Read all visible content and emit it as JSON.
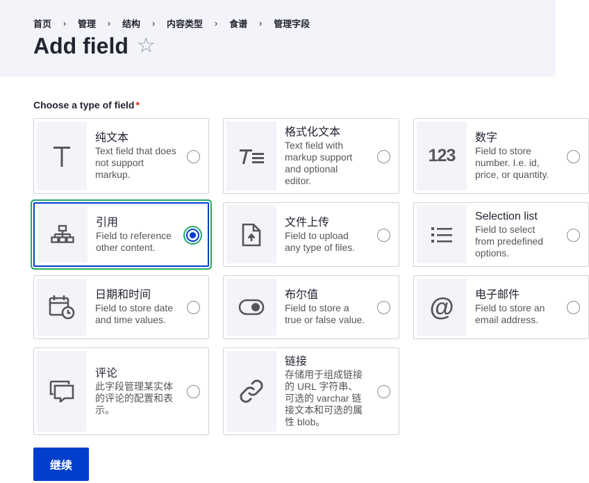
{
  "breadcrumb": [
    "首页",
    "管理",
    "结构",
    "内容类型",
    "食谱",
    "管理字段"
  ],
  "breadcrumb_separator": "›",
  "page_title": "Add field",
  "favorite_icon": "☆",
  "form": {
    "label": "Choose a type of field",
    "required_marker": "*"
  },
  "field_types": [
    {
      "name": "纯文本",
      "description": "Text field that does not support markup.",
      "icon": "plain-text-icon",
      "glyph": "T",
      "selected": false
    },
    {
      "name": "格式化文本",
      "description": "Text field with markup support and optional editor.",
      "icon": "formatted-text-icon",
      "glyph": "T≡",
      "selected": false
    },
    {
      "name": "数字",
      "description": "Field to store number. I.e. id, price, or quantity.",
      "icon": "number-icon",
      "glyph": "123",
      "selected": false
    },
    {
      "name": "引用",
      "description": "Field to reference other content.",
      "icon": "reference-icon",
      "selected": true
    },
    {
      "name": "文件上传",
      "description": "Field to upload any type of files.",
      "icon": "file-upload-icon",
      "selected": false
    },
    {
      "name": "Selection list",
      "description": "Field to select from predefined options.",
      "icon": "selection-list-icon",
      "selected": false
    },
    {
      "name": "日期和时间",
      "description": "Field to store date and time values.",
      "icon": "date-time-icon",
      "selected": false
    },
    {
      "name": "布尔值",
      "description": "Field to store a true or false value.",
      "icon": "boolean-icon",
      "selected": false
    },
    {
      "name": "电子邮件",
      "description": "Field to store an email address.",
      "icon": "email-icon",
      "glyph": "@",
      "selected": false
    },
    {
      "name": "评论",
      "description": "此字段管理某实体的评论的配置和表示。",
      "icon": "comment-icon",
      "selected": false
    },
    {
      "name": "链接",
      "description": "存储用于组成链接的 URL 字符串、可选的 varchar 链接文本和可选的属性 blob。",
      "icon": "link-icon",
      "selected": false
    }
  ],
  "continue_label": "继续",
  "colors": {
    "accent": "#003ecc",
    "focus_ring": "#26a769",
    "required": "#dc2323",
    "header_bg": "#f3f4f9"
  }
}
